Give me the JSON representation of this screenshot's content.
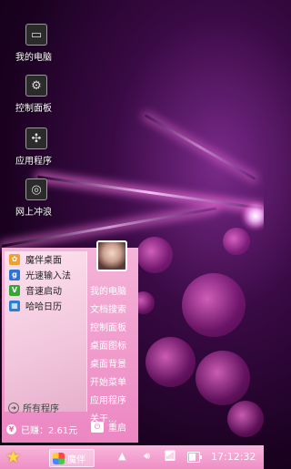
{
  "desktop": {
    "icons": [
      {
        "label": "我的电脑",
        "icon": "computer-icon"
      },
      {
        "label": "控制面板",
        "icon": "gear-icon"
      },
      {
        "label": "应用程序",
        "icon": "apps-icon"
      },
      {
        "label": "网上冲浪",
        "icon": "globe-icon"
      }
    ]
  },
  "start_menu": {
    "items": [
      {
        "label": "魔伴桌面",
        "icon": "pinwheel-icon",
        "color": "#f0a030"
      },
      {
        "label": "光速输入法",
        "icon": "g-logo-icon",
        "color": "#2f73d8"
      },
      {
        "label": "音速启动",
        "icon": "v-logo-icon",
        "color": "#3aa537"
      },
      {
        "label": "哈哈日历",
        "icon": "calendar-icon",
        "color": "#2a7fd0"
      }
    ],
    "all_programs": "所有程序",
    "links": [
      "我的电脑",
      "文档搜索",
      "控制面板",
      "桌面图标",
      "桌面背景",
      "开始菜单",
      "应用程序",
      "关于..."
    ],
    "earned": "已赚：2.61元",
    "restart": "重启"
  },
  "taskbar": {
    "app_label": "魔伴",
    "clock": "17:12:32",
    "battery_level": 0.7,
    "accent": "#ee8ec6"
  }
}
